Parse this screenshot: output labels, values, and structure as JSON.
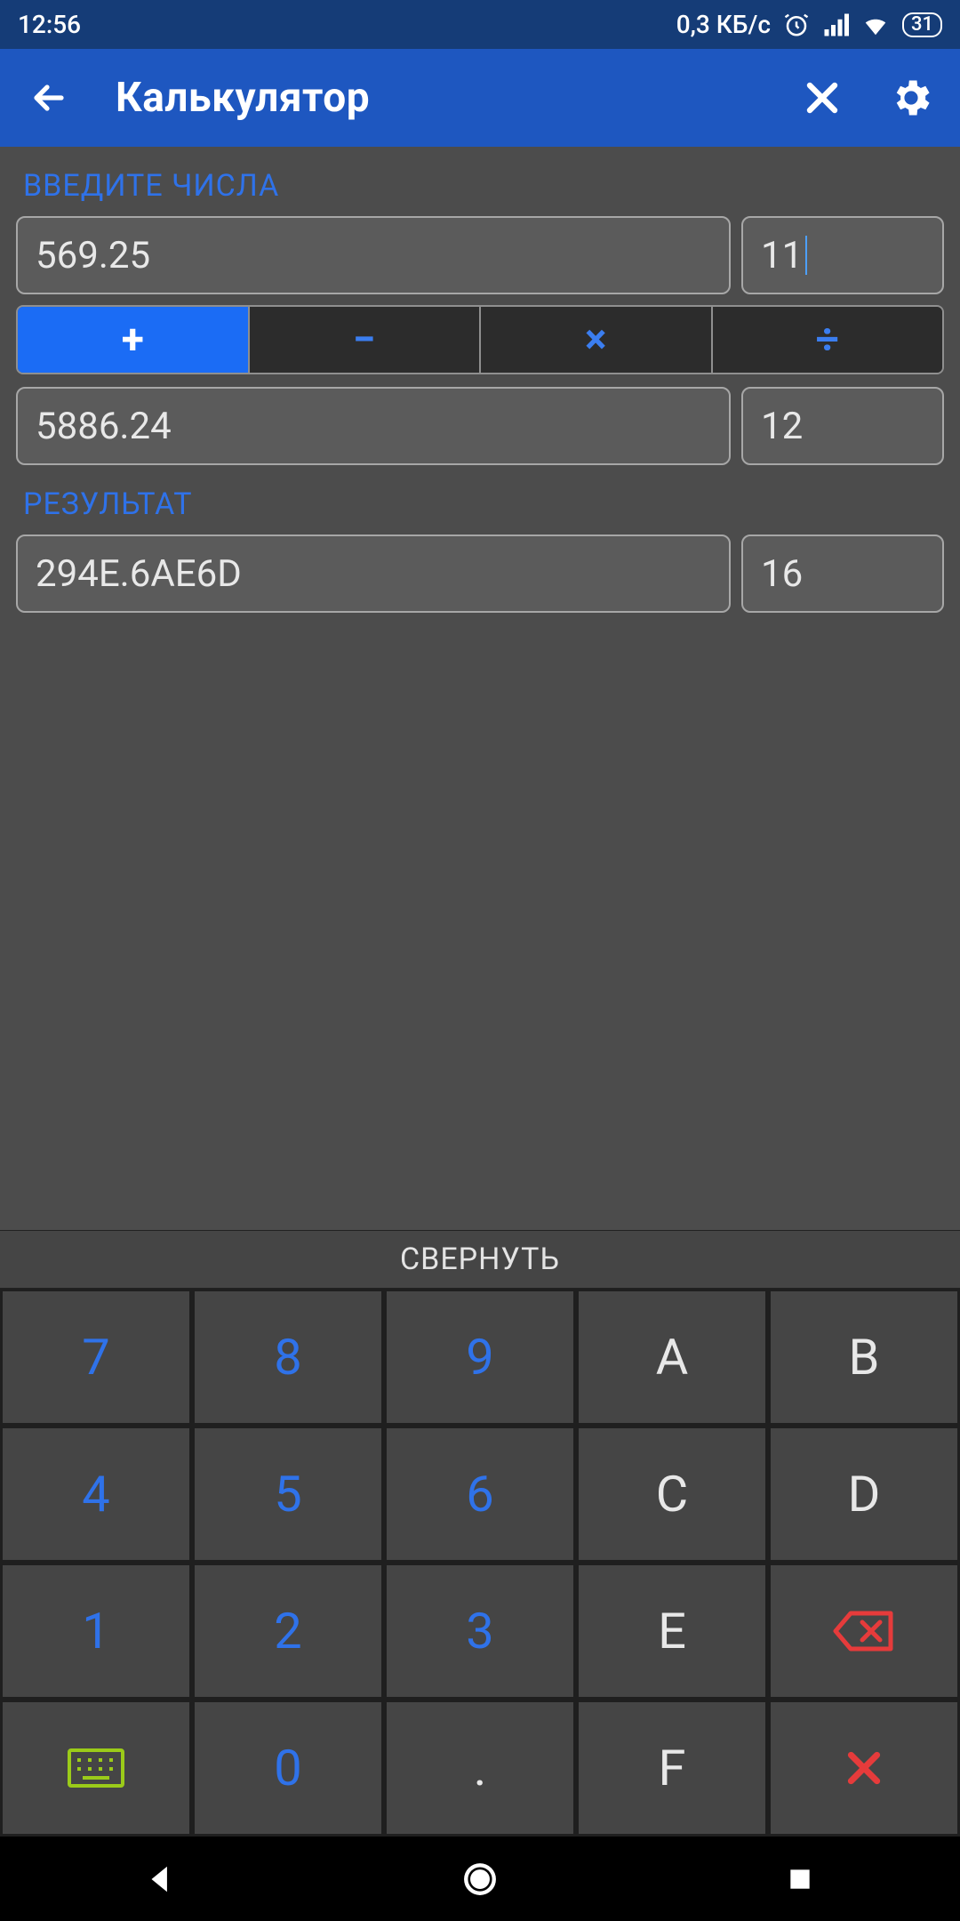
{
  "status": {
    "time": "12:56",
    "net_speed": "0,3 КБ/с",
    "battery": "31"
  },
  "appbar": {
    "title": "Калькулятор"
  },
  "labels": {
    "enter_numbers": "ВВЕДИТЕ ЧИСЛА",
    "result": "РЕЗУЛЬТАТ",
    "collapse": "СВЕРНУТЬ"
  },
  "inputs": {
    "operand1_value": "569.25",
    "operand1_base": "11",
    "operand2_value": "5886.24",
    "operand2_base": "12",
    "result_value": "294E.6AE6D",
    "result_base": "16"
  },
  "operations": {
    "add": "+",
    "sub": "−",
    "mul": "×",
    "div": "÷",
    "active": "add"
  },
  "keypad": {
    "k7": "7",
    "k8": "8",
    "k9": "9",
    "kA": "A",
    "kB": "B",
    "k4": "4",
    "k5": "5",
    "k6": "6",
    "kC": "C",
    "kD": "D",
    "k1": "1",
    "k2": "2",
    "k3": "3",
    "kE": "E",
    "k0": "0",
    "kdot": ".",
    "kF": "F"
  }
}
